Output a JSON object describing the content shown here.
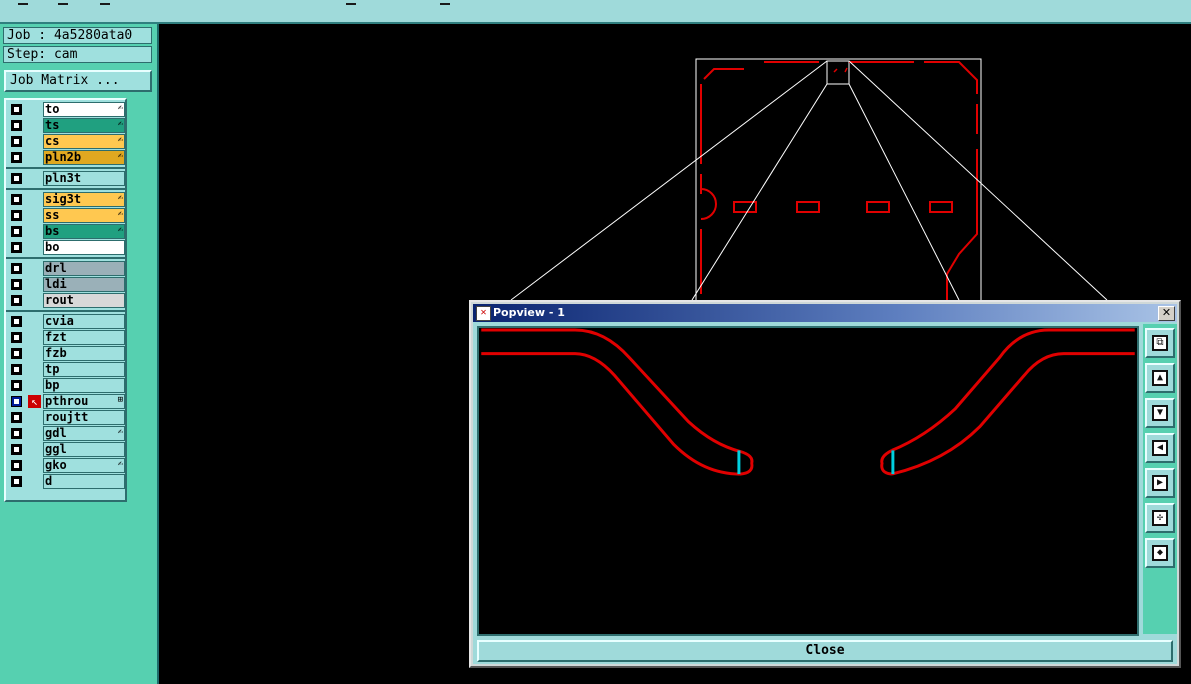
{
  "job_label": "Job : 4a5280ata0",
  "step_label": "Step: cam",
  "job_matrix_button": "Job Matrix ...",
  "layers": [
    {
      "name": "to",
      "color": "#ffffff",
      "mark": "✍"
    },
    {
      "name": "ts",
      "color": "#20a080",
      "mark": "✍"
    },
    {
      "name": "cs",
      "color": "#ffc850",
      "mark": "✍"
    },
    {
      "name": "pln2b",
      "color": "#e0a820",
      "mark": "✍"
    },
    {
      "name": "pln3t",
      "color": "#9fe0de",
      "mark": ""
    },
    {
      "name": "sig3t",
      "color": "#ffc850",
      "mark": "✍"
    },
    {
      "name": "ss",
      "color": "#ffc850",
      "mark": "✍"
    },
    {
      "name": "bs",
      "color": "#20a080",
      "mark": "✍"
    },
    {
      "name": "bo",
      "color": "#ffffff",
      "mark": ""
    },
    {
      "name": "drl",
      "color": "#9ab0b8",
      "mark": ""
    },
    {
      "name": "ldi",
      "color": "#9ab0b8",
      "mark": ""
    },
    {
      "name": "rout",
      "color": "#d8d8d8",
      "mark": ""
    },
    {
      "name": "cvia",
      "color": "#9fe0de",
      "mark": ""
    },
    {
      "name": "fzt",
      "color": "#9fe0de",
      "mark": ""
    },
    {
      "name": "fzb",
      "color": "#9fe0de",
      "mark": ""
    },
    {
      "name": "tp",
      "color": "#9fe0de",
      "mark": ""
    },
    {
      "name": "bp",
      "color": "#9fe0de",
      "mark": ""
    },
    {
      "name": "pthrou",
      "color": "#9fe0de",
      "mark": "⊞"
    },
    {
      "name": "roujtt",
      "color": "#9fe0de",
      "mark": ""
    },
    {
      "name": "gdl",
      "color": "#9fe0de",
      "mark": "✍"
    },
    {
      "name": "ggl",
      "color": "#9fe0de",
      "mark": ""
    },
    {
      "name": "gko",
      "color": "#9fe0de",
      "mark": "✍"
    },
    {
      "name": "d",
      "color": "#9fe0de",
      "mark": ""
    }
  ],
  "active_layer_index": 17,
  "popview": {
    "title": "Popview - 1",
    "close_button": "Close",
    "close_x": "✕",
    "tools": [
      "zoom-window-icon",
      "pan-up-icon",
      "pan-down-icon",
      "pan-left-icon",
      "pan-right-icon",
      "zoom-out-icon",
      "zoom-home-icon"
    ]
  },
  "colors": {
    "trace": "#e00000",
    "highlight": "#00d0e0",
    "outline": "#ffffff"
  }
}
